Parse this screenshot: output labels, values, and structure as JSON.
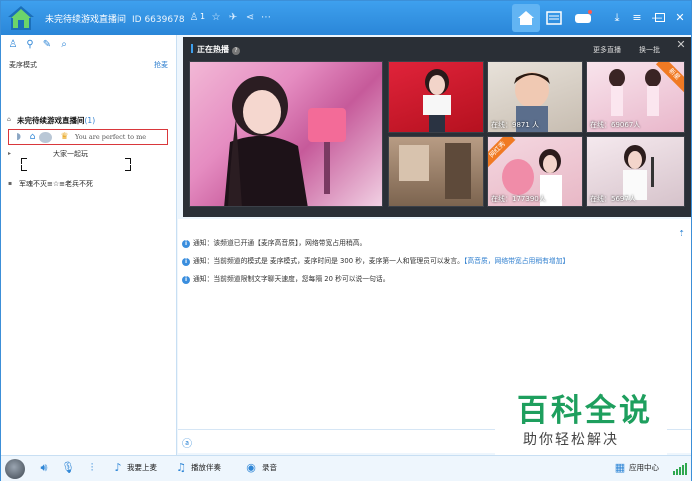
{
  "window": {
    "title": "未完待续游戏直播间",
    "id_text": "ID 6639678",
    "member_count": "1"
  },
  "left": {
    "mode_label": "麦序模式",
    "mode_link": "抢麦",
    "channel_name": "未完待续游戏直播间",
    "channel_count": "(1)",
    "user_signature": "You are perfect to me",
    "sub_channel": "大家一起玩",
    "channel2": "军魂不灭≡☆≡老兵不死"
  },
  "hot": {
    "title": "正在热播",
    "more_label": "更多直播",
    "refresh_label": "换一批",
    "thumbs": [
      {
        "online": ""
      },
      {
        "online": ""
      },
      {
        "online": "在线：9871 人"
      },
      {
        "online": "在线：69067人",
        "ribbon": "新星"
      },
      {
        "online": ""
      },
      {
        "online": "在线：177390人",
        "ribbon": "网红秀"
      },
      {
        "online": "在线：5697人"
      }
    ]
  },
  "chat": {
    "messages": [
      {
        "prefix": "通知：",
        "text": "该频道已开通【麦序高音质】，网络带宽占用稍高。",
        "highlight": ""
      },
      {
        "prefix": "通知：",
        "text": "当前频道的模式是 麦序模式，麦序时间是 300 秒，麦序第一人和管理员可以发言。",
        "highlight": "【高音质，网络带宽占用稍有增加】"
      },
      {
        "prefix": "通知：",
        "text": "当前频道限制文字聊天速度，您每隔 20 秒可以说一句话。",
        "highlight": ""
      }
    ]
  },
  "watermark": {
    "big": "百科全说",
    "small": "助你轻松解决"
  },
  "bottom": {
    "mic_label": "我要上麦",
    "play_label": "播放伴奏",
    "record_label": "录音",
    "app_center": "应用中心"
  },
  "colors": {
    "titlebar": "#2a86d8",
    "accent": "#2f86d6",
    "highlight_border": "#d9373b",
    "watermark_green": "#1e9f5e"
  }
}
